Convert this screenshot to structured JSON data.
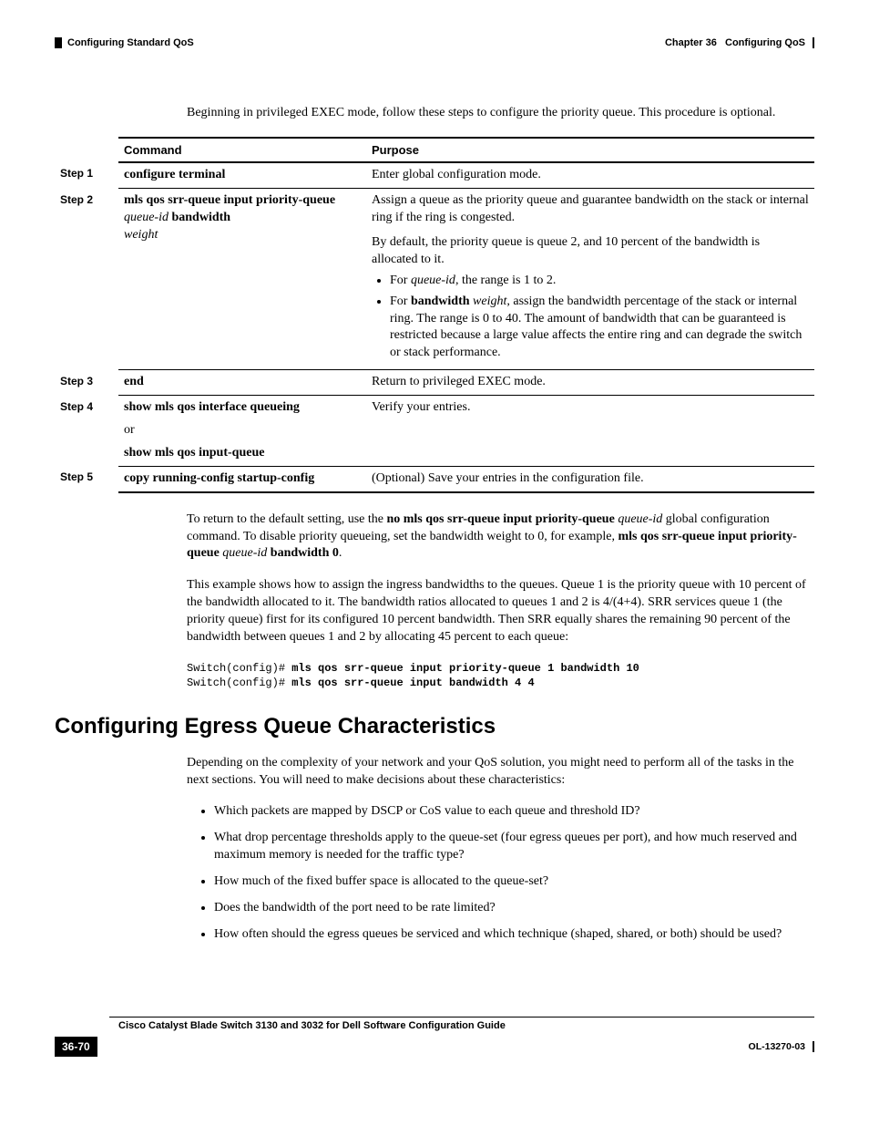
{
  "header": {
    "left": "Configuring Standard QoS",
    "chapter": "Chapter 36",
    "title": "Configuring QoS"
  },
  "intro": "Beginning in privileged EXEC mode, follow these steps to configure the priority queue. This procedure is optional.",
  "table": {
    "head_command": "Command",
    "head_purpose": "Purpose",
    "step1": {
      "label": "Step 1",
      "command_b": "configure terminal",
      "purpose": "Enter global configuration mode."
    },
    "step2": {
      "label": "Step 2",
      "cmd_l1a": "mls qos srr-queue input priority-queue ",
      "cmd_l1b": "queue-id",
      "cmd_l1c": " bandwidth",
      "cmd_l2": "weight",
      "p1": "Assign a queue as the priority queue and guarantee bandwidth on the stack or internal ring if the ring is congested.",
      "p2": "By default, the priority queue is queue 2, and 10 percent of the bandwidth is allocated to it.",
      "b1a": "For ",
      "b1b": "queue-id",
      "b1c": ", the range is 1 to 2.",
      "b2a": "For ",
      "b2b": "bandwidth",
      "b2c": " ",
      "b2d": "weight",
      "b2e": ", assign the bandwidth percentage of the stack or internal ring. The range is 0 to 40. The amount of bandwidth that can be guaranteed is restricted because a large value affects the entire ring and can degrade the switch or stack performance."
    },
    "step3": {
      "label": "Step 3",
      "command_b": "end",
      "purpose": "Return to privileged EXEC mode."
    },
    "step4": {
      "label": "Step 4",
      "cmd_b1": "show mls qos interface queueing",
      "or": "or",
      "cmd_b2": "show mls qos input-queue",
      "purpose": "Verify your entries."
    },
    "step5": {
      "label": "Step 5",
      "command_b": "copy running-config startup-config",
      "purpose": "(Optional) Save your entries in the configuration file."
    }
  },
  "post1": {
    "t1": "To return to the default setting, use the ",
    "b1": "no mls qos srr-queue input priority-queue",
    "t2": " ",
    "i1": "queue-id",
    "t3": " global configuration command. To disable priority queueing, set the bandwidth weight to 0, for example, ",
    "b2": "mls qos srr-queue input priority-queue",
    "t4": " ",
    "i2": "queue-id",
    "t5": " ",
    "b3": "bandwidth 0",
    "t6": "."
  },
  "post2": "This example shows how to assign the ingress bandwidths to the queues. Queue 1 is the priority queue with 10 percent of the bandwidth allocated to it. The bandwidth ratios allocated to queues 1 and 2 is 4/(4+4). SRR services queue 1 (the priority queue) first for its configured 10 percent bandwidth. Then SRR equally shares the remaining 90 percent of the bandwidth between queues 1 and 2 by allocating 45 percent to each queue:",
  "code": {
    "p1": "Switch(config)# ",
    "c1": "mls qos srr-queue input priority-queue 1 bandwidth 10",
    "p2": "Switch(config)# ",
    "c2": "mls qos srr-queue input bandwidth 4 4"
  },
  "h2": "Configuring Egress Queue Characteristics",
  "egress_intro": "Depending on the complexity of your network and your QoS solution, you might need to perform all of the tasks in the next sections. You will need to make decisions about these characteristics:",
  "bullets": {
    "b1": "Which packets are mapped by DSCP or CoS value to each queue and threshold ID?",
    "b2": "What drop percentage thresholds apply to the queue-set (four egress queues per port), and how much reserved and maximum memory is needed for the traffic type?",
    "b3": "How much of the fixed buffer space is allocated to the queue-set?",
    "b4": "Does the bandwidth of the port need to be rate limited?",
    "b5": "How often should the egress queues be serviced and which technique (shaped, shared, or both) should be used?"
  },
  "footer": {
    "book": "Cisco Catalyst Blade Switch 3130 and 3032 for Dell Software Configuration Guide",
    "page": "36-70",
    "doc": "OL-13270-03"
  }
}
